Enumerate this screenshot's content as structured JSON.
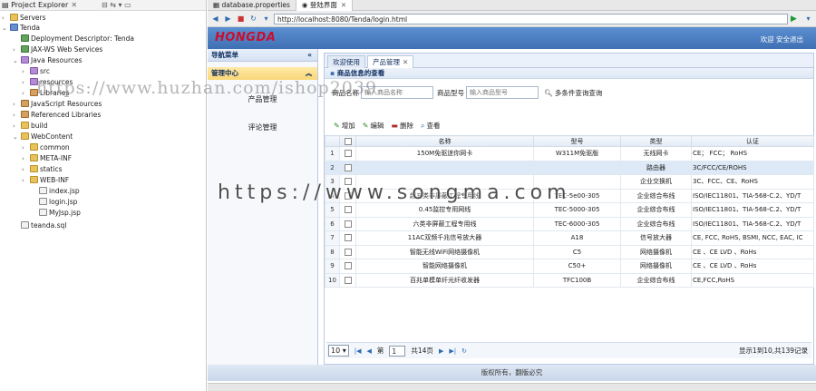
{
  "explorer": {
    "title": "Project Explorer",
    "items": [
      {
        "label": "Servers",
        "icon": "folder-icon"
      },
      {
        "label": "Tenda",
        "icon": "project-icon"
      },
      {
        "label": "Deployment Descriptor: Tenda",
        "icon": "web-icon"
      },
      {
        "label": "JAX-WS Web Services",
        "icon": "web-icon"
      },
      {
        "label": "Java Resources",
        "icon": "package-icon"
      },
      {
        "label": "src",
        "icon": "package-icon"
      },
      {
        "label": "resources",
        "icon": "package-icon"
      },
      {
        "label": "Libraries",
        "icon": "library-icon"
      },
      {
        "label": "JavaScript Resources",
        "icon": "library-icon"
      },
      {
        "label": "Referenced Libraries",
        "icon": "library-icon"
      },
      {
        "label": "build",
        "icon": "folder-icon"
      },
      {
        "label": "WebContent",
        "icon": "folder-icon"
      },
      {
        "label": "common",
        "icon": "folder-icon"
      },
      {
        "label": "META-INF",
        "icon": "folder-icon"
      },
      {
        "label": "statics",
        "icon": "folder-icon"
      },
      {
        "label": "WEB-INF",
        "icon": "folder-icon"
      },
      {
        "label": "index.jsp",
        "icon": "file-icon"
      },
      {
        "label": "login.jsp",
        "icon": "file-icon"
      },
      {
        "label": "MyJsp.jsp",
        "icon": "file-icon"
      },
      {
        "label": "teanda.sql",
        "icon": "file-icon"
      }
    ]
  },
  "editor": {
    "tabs": [
      {
        "label": "database.properties"
      },
      {
        "label": "登陆界面"
      }
    ],
    "url": "http://localhost:8080/Tenda/login.html"
  },
  "page": {
    "logo": "HONGDA",
    "welcome": "欢迎 安全退出",
    "nav": {
      "title": "导航菜单",
      "section": "管理中心",
      "items": [
        "产品管理",
        "评论管理"
      ]
    },
    "tabs": [
      {
        "label": "欢迎使用"
      },
      {
        "label": "产品管理"
      }
    ],
    "panel_title": "商品信息的查看",
    "search": {
      "name_label": "商品名称",
      "name_placeholder": "输入商品名称",
      "model_label": "商品型号",
      "model_placeholder": "输入商品型号",
      "button": "多条件查询查询"
    },
    "toolbar": {
      "add": "增加",
      "edit": "编辑",
      "delete": "删除",
      "view": "查看"
    },
    "grid": {
      "columns": [
        "",
        "",
        "名称",
        "型号",
        "类型",
        "认证"
      ],
      "rows": [
        {
          "n": "1",
          "name": "150M免驱迷你网卡",
          "model": "W311M免驱版",
          "type": "无线网卡",
          "cert": "CE； FCC； RoHS"
        },
        {
          "n": "2",
          "name": "",
          "model": "",
          "type": "路由器",
          "cert": "3C/FCC/CE/ROHS"
        },
        {
          "n": "3",
          "name": "",
          "model": "",
          "type": "企业交换机",
          "cert": "3C、FCC、CE、RoHS"
        },
        {
          "n": "4",
          "name": "超五类非屏蔽工程专用线",
          "model": "TEC-5e00-305",
          "type": "企业综合布线",
          "cert": "ISO/IEC11801、TIA-568-C.2、YD/T"
        },
        {
          "n": "5",
          "name": "0.45监控专用网线",
          "model": "TEC-5000-305",
          "type": "企业综合布线",
          "cert": "ISO/IEC11801、TIA-568-C.2、YD/T"
        },
        {
          "n": "6",
          "name": "六类非屏蔽工程专用线",
          "model": "TEC-6000-305",
          "type": "企业综合布线",
          "cert": "ISO/IEC11801、TIA-568-C.2、YD/T"
        },
        {
          "n": "7",
          "name": "11AC双频千兆信号放大器",
          "model": "A18",
          "type": "信号放大器",
          "cert": "CE, FCC, RoHS, BSMI, NCC, EAC, IC"
        },
        {
          "n": "8",
          "name": "智能无线WiFi网络摄像机",
          "model": "C5",
          "type": "网络摄像机",
          "cert": "CE 、CE LVD 、RoHs"
        },
        {
          "n": "9",
          "name": "智能网络摄像机",
          "model": "C50+",
          "type": "网络摄像机",
          "cert": "CE 、CE LVD 、RoHs"
        },
        {
          "n": "10",
          "name": "百兆单模单纤光纤收发器",
          "model": "TFC100B",
          "type": "企业综合布线",
          "cert": "CE,FCC,RoHS"
        }
      ]
    },
    "pager": {
      "page_size": "10",
      "page_label_pre": "第",
      "page_value": "1",
      "page_label_post": "共14页",
      "info": "显示1到10,共139记录"
    },
    "footer": "版权所有，翻版必究"
  },
  "watermarks": {
    "top": "https://www.huzhan.com/ishop2039",
    "center": "https://www.songma.com"
  }
}
